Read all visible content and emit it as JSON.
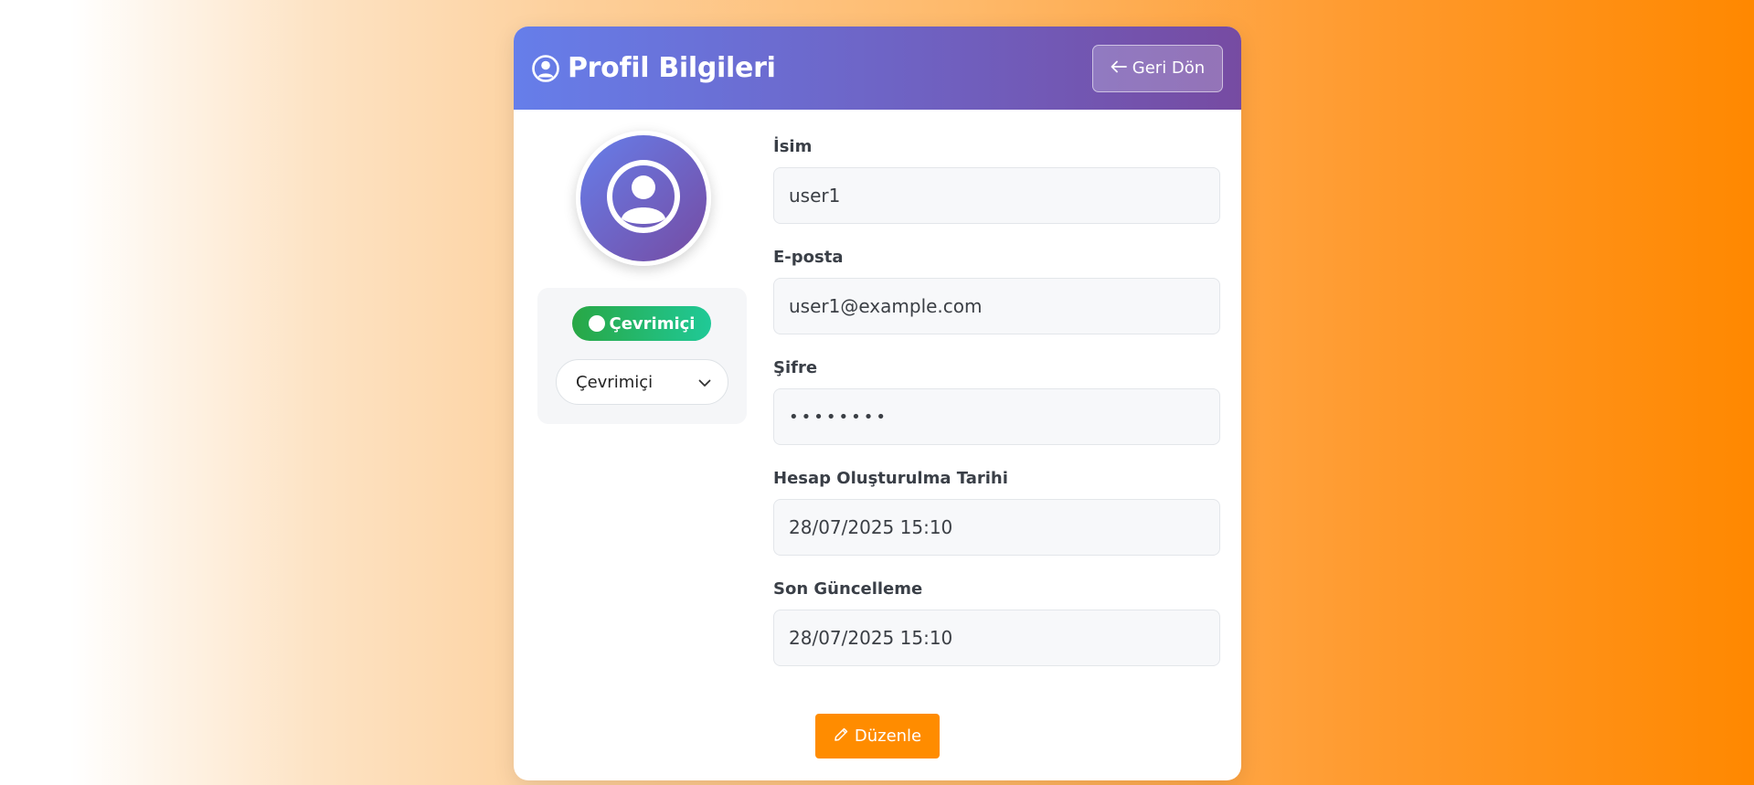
{
  "header": {
    "title": "Profil Bilgileri",
    "title_icon": "user-circle-icon",
    "back_button": {
      "label": "Geri Dön",
      "icon": "arrow-left-icon"
    }
  },
  "profile": {
    "avatar_icon": "user-circle-icon",
    "status_badge": {
      "label": "Çevrimiçi",
      "color": "#28a745"
    },
    "status_select": {
      "selected": "Çevrimiçi",
      "icon": "chevron-down-icon"
    }
  },
  "form": {
    "name": {
      "label": "İsim",
      "value": "user1"
    },
    "email": {
      "label": "E-posta",
      "value": "user1@example.com"
    },
    "password": {
      "label": "Şifre",
      "value": "••••••••"
    },
    "created": {
      "label": "Hesap Oluşturulma Tarihi",
      "value": "28/07/2025 15:10"
    },
    "updated": {
      "label": "Son Güncelleme",
      "value": "28/07/2025 15:10"
    }
  },
  "actions": {
    "edit_button": {
      "label": "Düzenle",
      "icon": "pencil-icon"
    }
  },
  "colors": {
    "header_gradient_start": "#667eea",
    "header_gradient_end": "#764ba2",
    "accent_orange": "#ff8c00",
    "status_green": "#28a745"
  }
}
